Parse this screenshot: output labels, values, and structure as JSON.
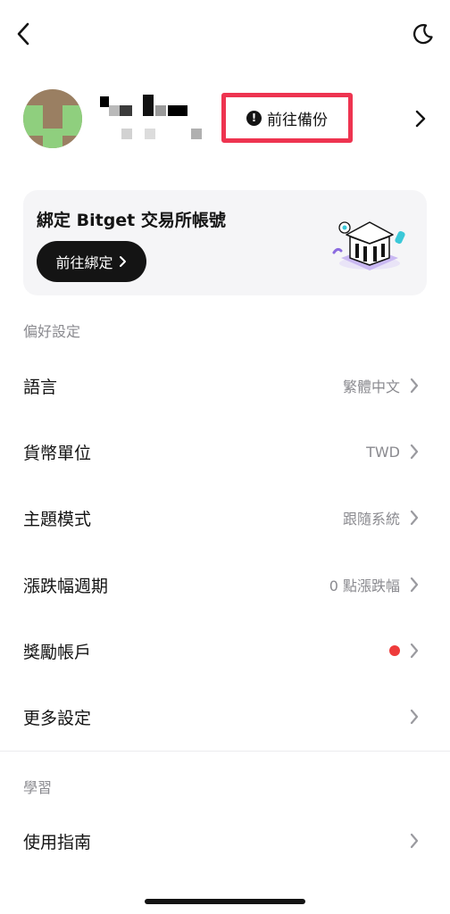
{
  "header": {
    "back_icon": "chevron-left-icon",
    "theme_icon": "moon-icon"
  },
  "profile": {
    "backup_label": "前往備份",
    "warning_icon": "exclamation-icon",
    "accent": "#ee3450"
  },
  "bind_card": {
    "title": "綁定 Bitget 交易所帳號",
    "button_label": "前往綁定"
  },
  "preferences": {
    "section_title": "偏好設定",
    "items": [
      {
        "label": "語言",
        "value": "繁體中文"
      },
      {
        "label": "貨幣單位",
        "value": "TWD"
      },
      {
        "label": "主題模式",
        "value": "跟隨系統"
      },
      {
        "label": "漲跌幅週期",
        "value": "0 點漲跌幅"
      },
      {
        "label": "獎勵帳戶",
        "value": ""
      },
      {
        "label": "更多設定",
        "value": ""
      }
    ],
    "notification_dot_color": "#ee3b3b"
  },
  "learning": {
    "section_title": "學習",
    "items": [
      {
        "label": "使用指南",
        "value": ""
      }
    ]
  }
}
